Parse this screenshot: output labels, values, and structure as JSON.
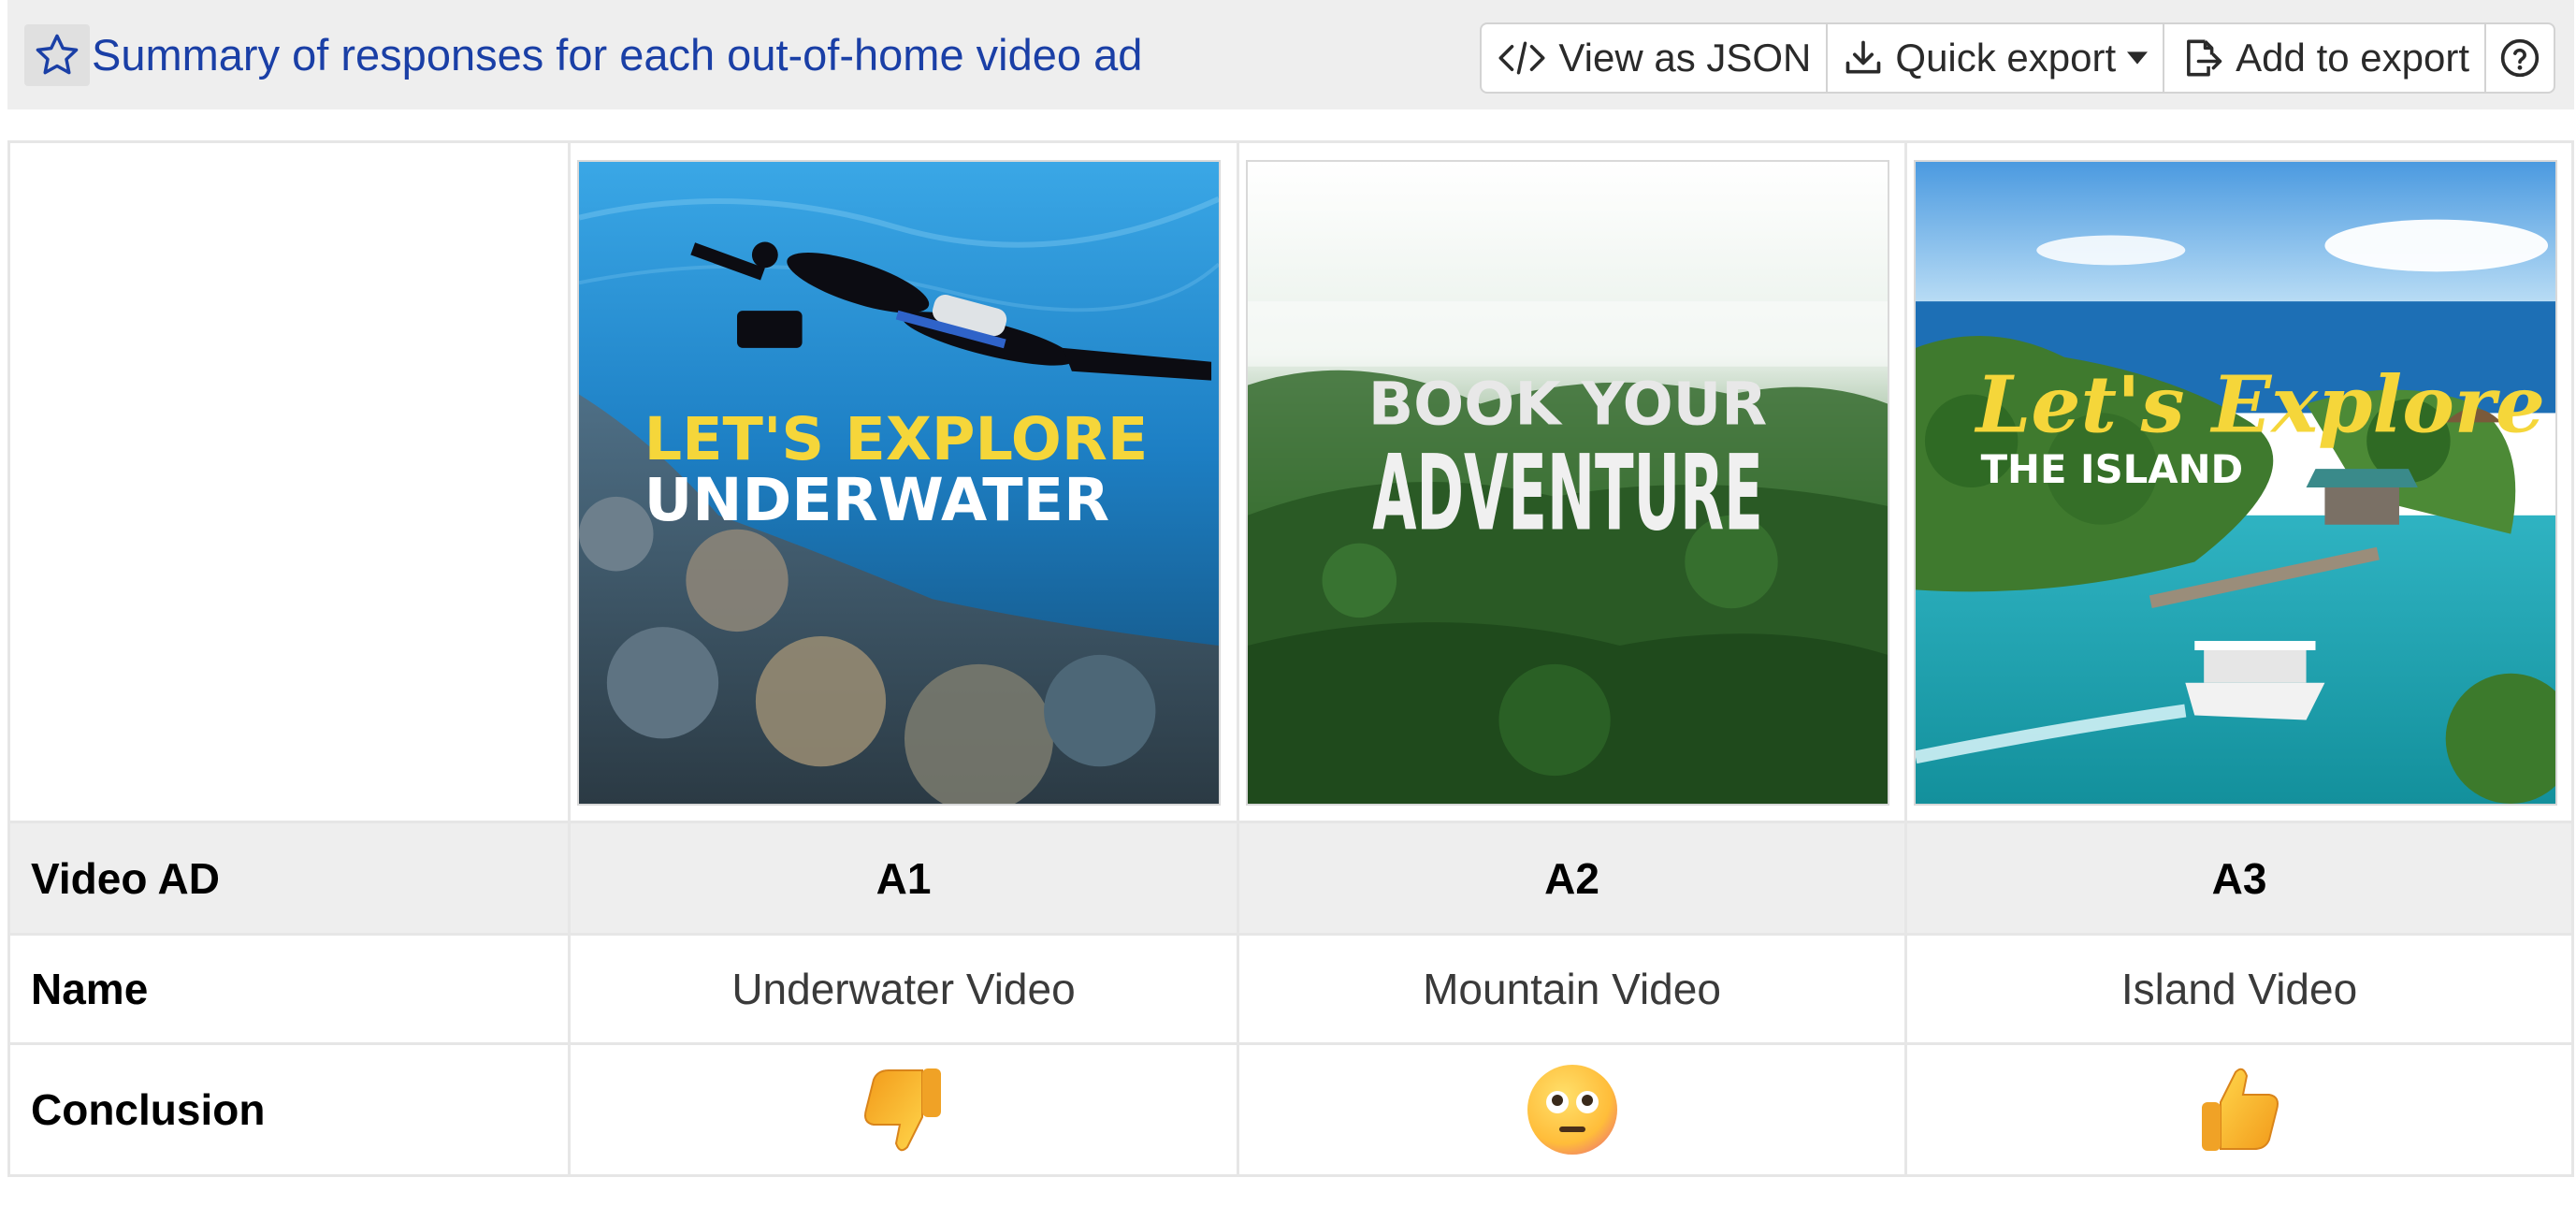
{
  "header": {
    "title": "Summary of responses for each out-of-home video ad",
    "star_icon": "star-outline-icon",
    "buttons": [
      {
        "label": "View as JSON",
        "icon": "code-icon"
      },
      {
        "label": "Quick export",
        "icon": "download-icon",
        "caret": "caret-down-icon"
      },
      {
        "label": "Add to export",
        "icon": "file-export-icon"
      },
      {
        "label": "",
        "icon": "help-circle-icon"
      }
    ],
    "title_color": "#1a3fa6"
  },
  "ads": [
    {
      "id": "A1",
      "name": "Underwater Video",
      "conclusion_icon": "thumbs-down-icon",
      "thumbnail": {
        "line1": "LET'S EXPLORE",
        "line2": "UNDERWATER",
        "scene": "diver over coral reef"
      }
    },
    {
      "id": "A2",
      "name": "Mountain Video",
      "conclusion_icon": "neutral-face-icon",
      "thumbnail": {
        "line1": "BOOK YOUR",
        "line2": "ADVENTURE",
        "scene": "misty forested mountains"
      }
    },
    {
      "id": "A3",
      "name": "Island Video",
      "conclusion_icon": "thumbs-up-icon",
      "thumbnail": {
        "line1": "Let's Explore",
        "line2": "THE ISLAND",
        "scene": "tropical island with boat"
      }
    }
  ],
  "rows": {
    "video_ad": "Video AD",
    "name": "Name",
    "conclusion": "Conclusion"
  },
  "colors": {
    "header_bg": "#eeeeee",
    "row_highlight": "#eeeeee",
    "accent_yellow": "#f5d63a"
  }
}
